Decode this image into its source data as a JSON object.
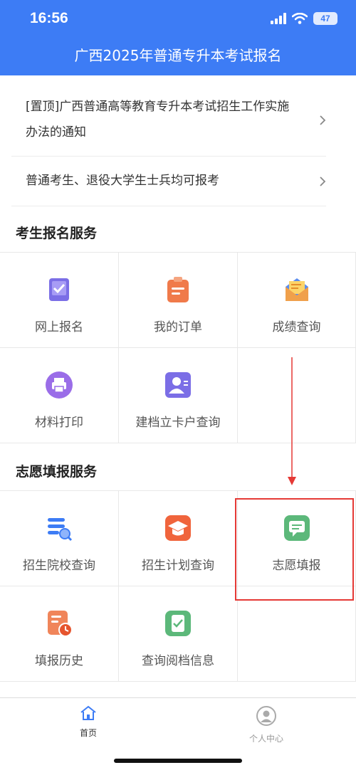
{
  "status_bar": {
    "time": "16:56",
    "battery": "47"
  },
  "header": {
    "title": "广西2025年普通专升本考试报名"
  },
  "notices": [
    {
      "line1": "[置顶]广西普通高等教育专升本考试招生工作实施",
      "line2": "办法的通知"
    },
    {
      "line1": "普通考生、退役大学生士兵均可报考"
    }
  ],
  "sections": {
    "registration": {
      "title": "考生报名服务",
      "items": [
        {
          "label": "网上报名",
          "icon": "book-check-icon"
        },
        {
          "label": "我的订单",
          "icon": "clipboard-icon"
        },
        {
          "label": "成绩查询",
          "icon": "envelope-icon"
        },
        {
          "label": "材料打印",
          "icon": "printer-icon"
        },
        {
          "label": "建档立卡户查询",
          "icon": "person-card-icon"
        }
      ]
    },
    "volunteer": {
      "title": "志愿填报服务",
      "items": [
        {
          "label": "招生院校查询",
          "icon": "list-search-icon"
        },
        {
          "label": "招生计划查询",
          "icon": "graduation-cap-icon"
        },
        {
          "label": "志愿填报",
          "icon": "chat-bubble-icon"
        },
        {
          "label": "填报历史",
          "icon": "history-clock-icon"
        },
        {
          "label": "查询阅档信息",
          "icon": "document-check-icon"
        }
      ]
    }
  },
  "bottom_nav": [
    {
      "label": "首页",
      "icon": "home-icon",
      "active": true
    },
    {
      "label": "个人中心",
      "icon": "user-circle-icon",
      "active": false
    }
  ],
  "colors": {
    "header": "#3d7cf5",
    "annotation": "#e53935"
  }
}
